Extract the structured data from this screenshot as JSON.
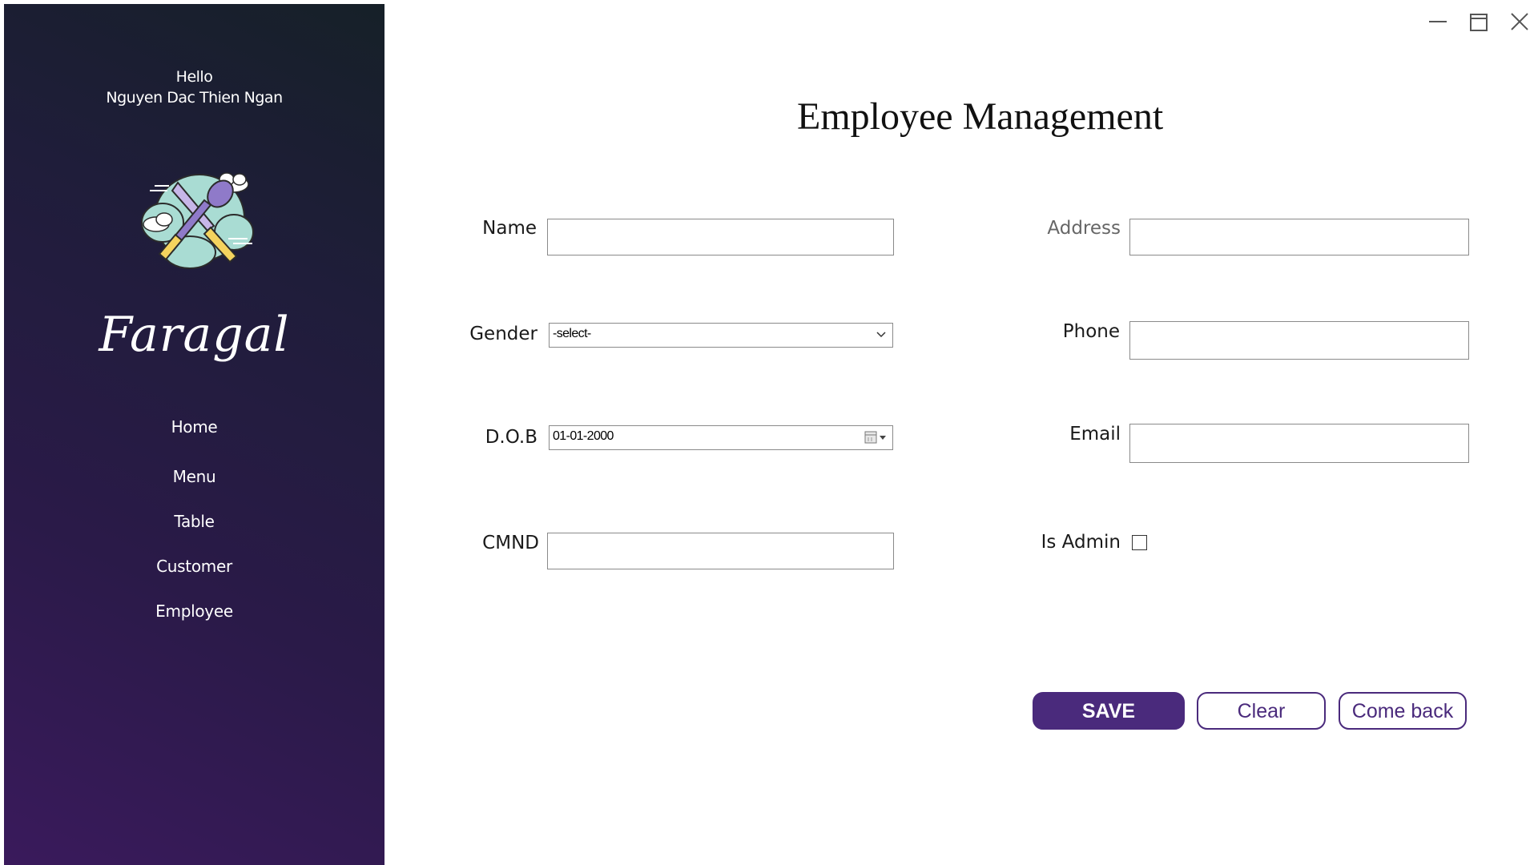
{
  "window": {
    "title": "Employee Management"
  },
  "sidebar": {
    "greeting_line1": "Hello",
    "greeting_line2": "Nguyen Dac Thien Ngan",
    "logo_icon": "crossed-spoon-knife-cloud-icon",
    "brand": "Faragal",
    "items": [
      {
        "label": "Home"
      },
      {
        "label": "Menu"
      },
      {
        "label": "Table"
      },
      {
        "label": "Customer"
      },
      {
        "label": "Employee"
      }
    ]
  },
  "form": {
    "name_label": "Name",
    "name_value": "",
    "gender_label": "Gender",
    "gender_value": "-select-",
    "dob_label": "D.O.B",
    "dob_value": "01-01-2000",
    "cmnd_label": "CMND",
    "cmnd_value": "",
    "address_label": "Address",
    "address_value": "",
    "phone_label": "Phone",
    "phone_value": "",
    "email_label": "Email",
    "email_value": "",
    "is_admin_label": "Is Admin",
    "is_admin_checked": false
  },
  "actions": {
    "save_label": "SAVE",
    "clear_label": "Clear",
    "back_label": "Come back"
  },
  "colors": {
    "accent": "#4a2a7c",
    "sidebar_dark": "#1f1d3a"
  }
}
